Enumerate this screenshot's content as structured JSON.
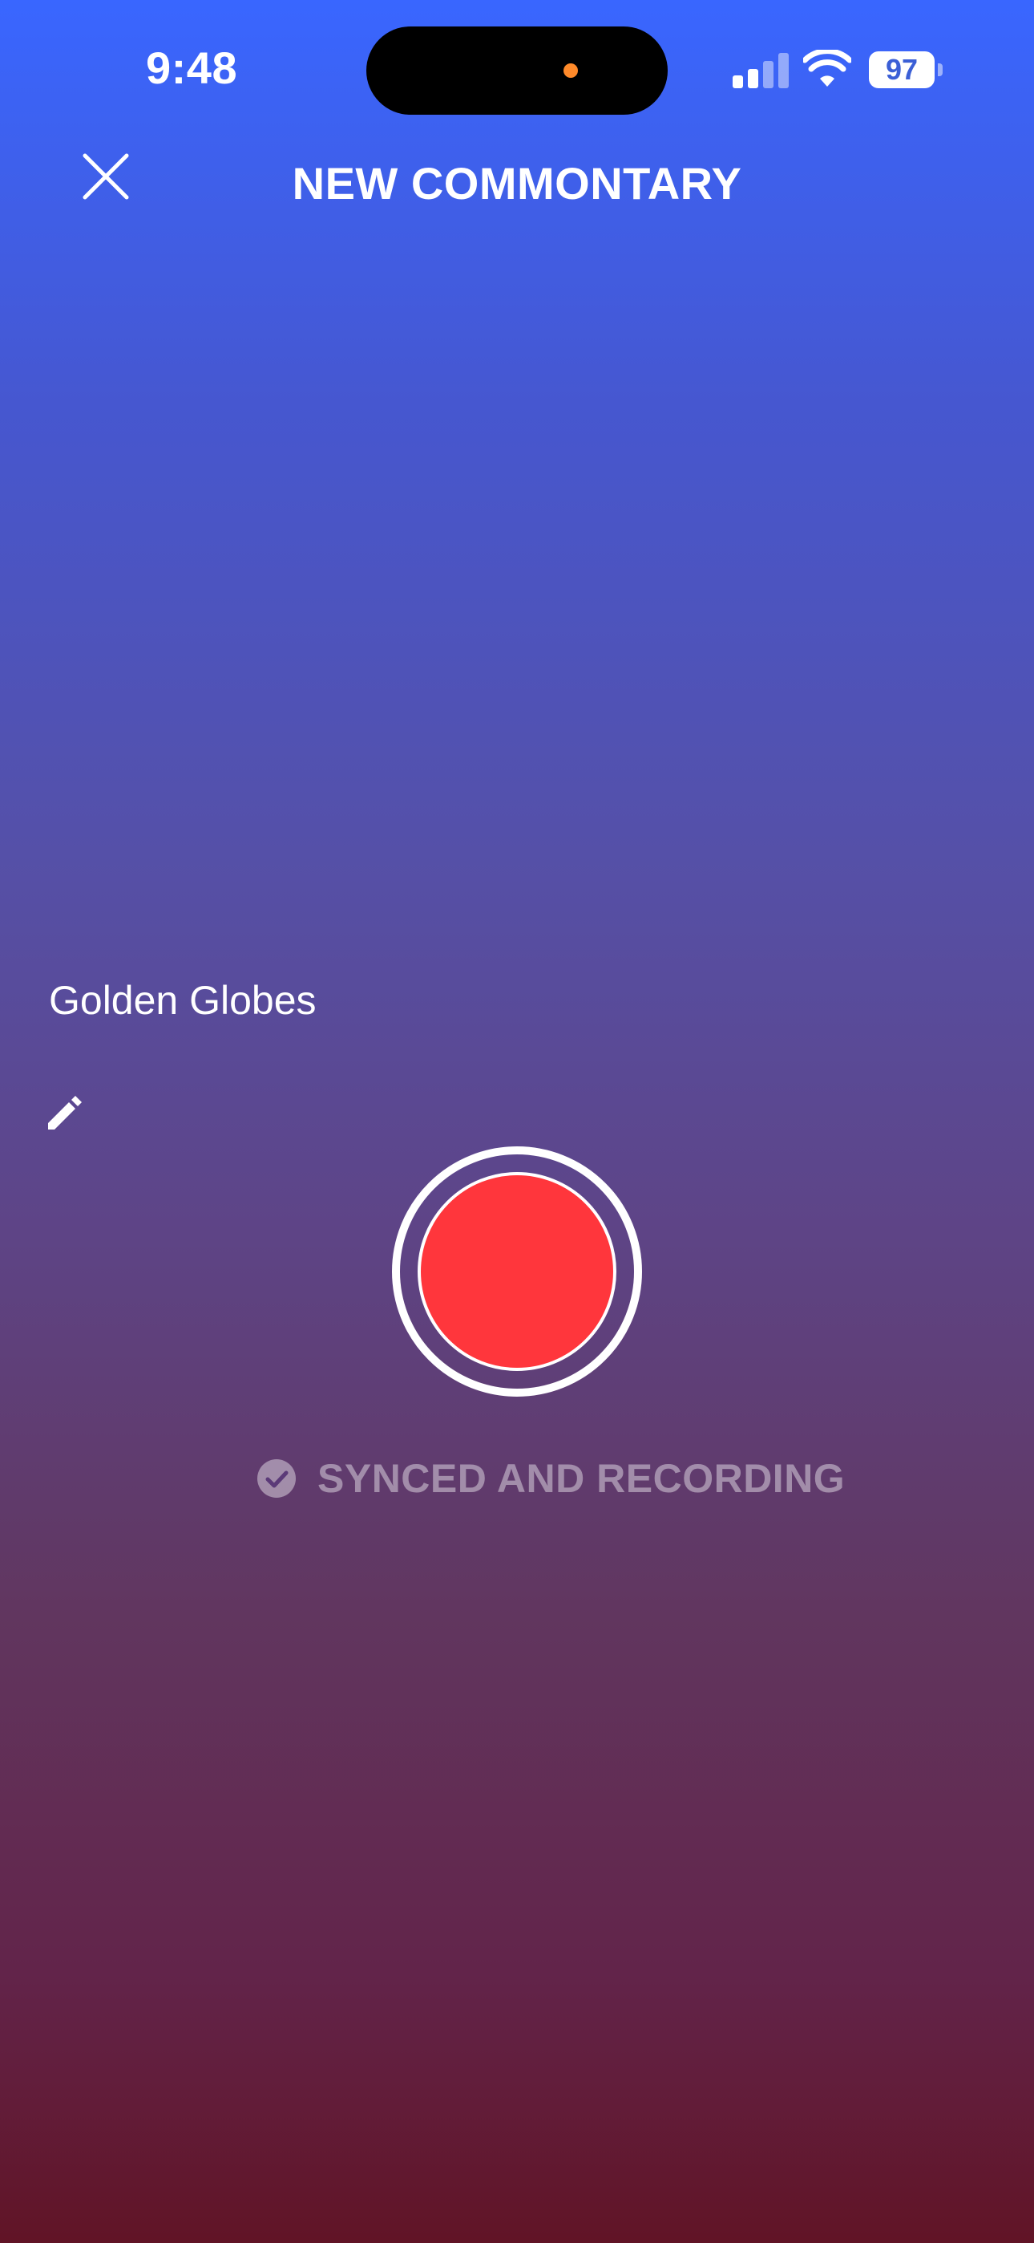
{
  "status_bar": {
    "time": "9:48",
    "battery": "97"
  },
  "header": {
    "title": "NEW COMMONTARY",
    "close_icon": "close-icon"
  },
  "commentary": {
    "title": "Golden Globes",
    "edit_icon": "pencil-icon"
  },
  "recorder": {
    "status": "SYNCED AND RECORDING",
    "status_icon": "check-circle-icon",
    "record_color": "#FF363C"
  },
  "colors": {
    "gradient_top": "#3966FF",
    "gradient_bottom": "#611426"
  }
}
